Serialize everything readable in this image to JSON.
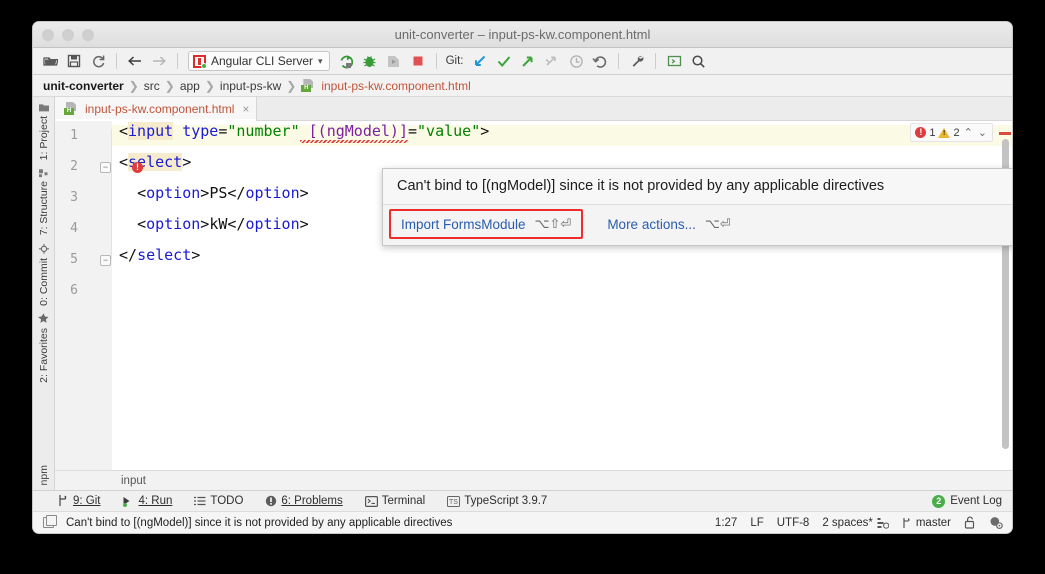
{
  "window": {
    "title": "unit-converter – input-ps-kw.component.html"
  },
  "toolbar": {
    "icons": [
      "open-folder-icon",
      "save-icon",
      "sync-icon",
      "back-arrow-icon",
      "forward-arrow-icon"
    ],
    "run_config": {
      "label": "Angular CLI Server",
      "dropdown": "▾"
    },
    "run_icons": [
      "run-icon",
      "debug-icon",
      "run-with-coverage-icon",
      "stop-icon"
    ],
    "git_label": "Git:",
    "git_icons": [
      "update-project-icon",
      "commit-icon",
      "push-icon",
      "no-op-icon",
      "history-icon",
      "rollback-icon"
    ],
    "right_icons": [
      "settings-wrench-icon",
      "terminal-icon",
      "search-everywhere-icon"
    ]
  },
  "breadcrumb": {
    "root": "unit-converter",
    "items": [
      "src",
      "app",
      "input-ps-kw"
    ],
    "file": "input-ps-kw.component.html",
    "separator": "❯"
  },
  "tabs": [
    {
      "label": "input-ps-kw.component.html",
      "close": "×"
    }
  ],
  "left_sidebar": {
    "items": [
      {
        "label": "1: Project",
        "icon": "project-folder-icon"
      },
      {
        "label": "7: Structure",
        "icon": "structure-icon"
      },
      {
        "label": "0: Commit",
        "icon": "commit-icon"
      },
      {
        "label": "2: Favorites",
        "icon": "star-icon"
      }
    ],
    "bottom": {
      "label": "npm",
      "icon": "npm-icon"
    }
  },
  "editor": {
    "line_numbers": [
      "1",
      "2",
      "3",
      "4",
      "5",
      "6"
    ],
    "lines": [
      {
        "no": "1",
        "text": "<input type=\"number\" [(ngModel)]=\"value\">"
      },
      {
        "no": "2",
        "text": "<select>"
      },
      {
        "no": "3",
        "text": "  <option>PS</option>"
      },
      {
        "no": "4",
        "text": "  <option>kW</option>"
      },
      {
        "no": "5",
        "text": "</select>"
      },
      {
        "no": "6",
        "text": ""
      }
    ],
    "tokens": {
      "l1_open": "<",
      "l1_tag": "input",
      "l1_attr": " type",
      "l1_eq": "=",
      "l1_val": "\"number\"",
      "l1_ngmodel": " [(ngModel)]",
      "l1_eq2": "=",
      "l1_val2": "\"value\"",
      "l1_close": ">",
      "l2": "<select>",
      "l2_open": "<",
      "l2_tag": "select",
      "l2_gt": ">",
      "l3_indent": "  ",
      "l3_open": "<",
      "l3_tag": "option",
      "l3_gt": ">",
      "l3_text": "PS",
      "l3_closeopen": "</",
      "l3_closetag": "option",
      "l3_closegt": ">",
      "l4_text": "kW",
      "l5_open": "</",
      "l5_tag": "select",
      "l5_gt": ">"
    },
    "error_marker": "!",
    "bottom_status": "input",
    "inspection": {
      "error_icon": "!",
      "error_count": "1",
      "warning_count": "2",
      "up_chevron": "⌃",
      "down_chevron": "⌄"
    }
  },
  "popup": {
    "message": "Can't bind to [(ngModel)] since it is not provided by any applicable directives",
    "actions": [
      {
        "label": "Import FormsModule",
        "shortcut": "⌥⇧⏎",
        "highlighted": true
      },
      {
        "label": "More actions...",
        "shortcut": "⌥⏎",
        "highlighted": false
      }
    ]
  },
  "status_bar": {
    "items": [
      {
        "label": "9: Git",
        "icon": "git-branch-icon"
      },
      {
        "label": "4: Run",
        "icon": "run-green-icon"
      },
      {
        "label": "TODO",
        "icon": "todo-list-icon"
      },
      {
        "label": "6: Problems",
        "icon": "problems-icon"
      },
      {
        "label": "Terminal",
        "icon": "terminal-icon"
      },
      {
        "label": "TypeScript 3.9.7",
        "icon": "typescript-icon"
      }
    ],
    "event_log": {
      "count": "2",
      "label": "Event Log"
    }
  },
  "message_bar": {
    "message": "Can't bind to [(ngModel)] since it is not provided by any applicable directives",
    "caret_position": "1:27",
    "line_separator": "LF",
    "encoding": "UTF-8",
    "indent": "2 spaces*",
    "branch": "master",
    "icons": [
      "indent-config-icon",
      "git-branch-icon",
      "lock-icon",
      "inspections-icon"
    ]
  },
  "colors": {
    "accent_red": "#ef2c2c",
    "link_blue": "#2a5db0",
    "tag_blue": "#1a1ad6",
    "string_green": "#008000",
    "ngmodel_purple": "#7b1fa2",
    "error_red": "#dc3c3c",
    "warning_yellow": "#e8b830",
    "current_line": "#fbfae4"
  }
}
